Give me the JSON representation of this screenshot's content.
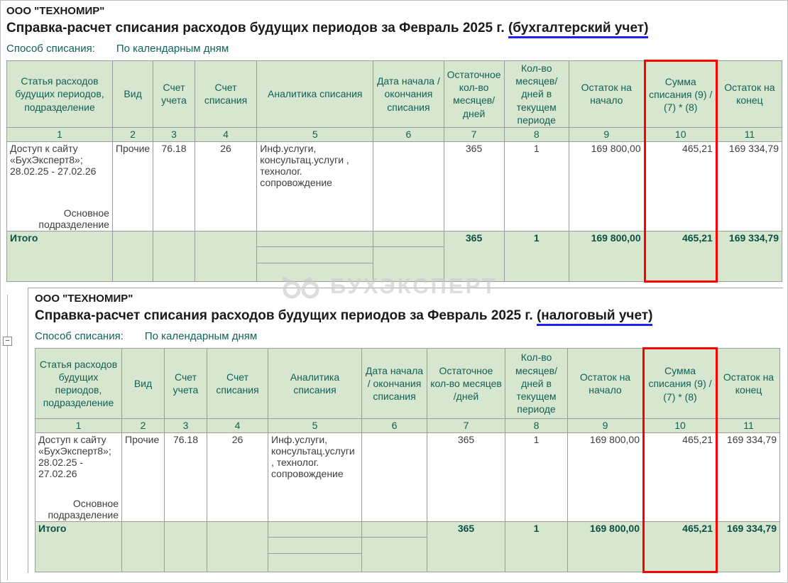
{
  "watermark": {
    "text": "БУХЭКСПЕРТ",
    "icon": "owl-glasses-icon"
  },
  "colors": {
    "header_green": "#d7e7cf",
    "teal_text": "#135f56",
    "highlight_red": "#ff0000",
    "underline_blue": "#2222ee"
  },
  "expander_glyph": "−",
  "blocks": [
    {
      "company": "ООО \"ТЕХНОМИР\"",
      "title": "Справка-расчет списания расходов будущих периодов за Февраль 2025 г.",
      "title_highlight": "(бухгалтерский учет)",
      "method_label": "Способ списания:",
      "method_value": "По календарным дням",
      "columns": [
        "Статья расходов будущих периодов, подразделение",
        "Вид",
        "Счет учета",
        "Счет списания",
        "Аналитика списания",
        "Дата начала / окончания списания",
        "Остаточное кол-во месяцев/ дней",
        "Кол-во месяцев/ дней в текущем периоде",
        "Остаток на начало",
        "Сумма списания (9) / (7) * (8)",
        "Остаток на конец"
      ],
      "column_numbers": [
        "1",
        "2",
        "3",
        "4",
        "5",
        "6",
        "7",
        "8",
        "9",
        "10",
        "11"
      ],
      "row": {
        "article": "Доступ к сайту «БухЭксперт8»; 28.02.25 - 27.02.26",
        "department": "Основное подразделение",
        "kind": "Прочие",
        "account": "76.18",
        "writeoff_account": "26",
        "analytics": "Инф.услуги, консультац.услуги , технолог. сопровождение",
        "remaining_qty": "365",
        "period_qty": "1",
        "balance_start": "169 800,00",
        "writeoff_sum": "465,21",
        "balance_end": "169 334,79"
      },
      "totals": {
        "label": "Итого",
        "remaining_qty": "365",
        "period_qty": "1",
        "balance_start": "169 800,00",
        "writeoff_sum": "465,21",
        "balance_end": "169 334,79"
      }
    },
    {
      "company": "ООО \"ТЕХНОМИР\"",
      "title": "Справка-расчет списания расходов будущих периодов за Февраль 2025 г.",
      "title_highlight": "(налоговый учет)",
      "method_label": "Способ списания:",
      "method_value": "По календарным дням",
      "columns": [
        "Статья расходов будущих периодов, подразделение",
        "Вид",
        "Счет учета",
        "Счет списания",
        "Аналитика списания",
        "Дата начала / окончания списания",
        "Остаточное кол-во месяцев /дней",
        "Кол-во месяцев/ дней в текущем периоде",
        "Остаток на начало",
        "Сумма списания (9) / (7) * (8)",
        "Остаток на конец"
      ],
      "column_numbers": [
        "1",
        "2",
        "3",
        "4",
        "5",
        "6",
        "7",
        "8",
        "9",
        "10",
        "11"
      ],
      "row": {
        "article": "Доступ к сайту «БухЭксперт8»; 28.02.25 - 27.02.26",
        "department": "Основное подразделение",
        "kind": "Прочие",
        "account": "76.18",
        "writeoff_account": "26",
        "analytics": "Инф.услуги, консультац.услуги , технолог. сопровождение",
        "remaining_qty": "365",
        "period_qty": "1",
        "balance_start": "169 800,00",
        "writeoff_sum": "465,21",
        "balance_end": "169 334,79"
      },
      "totals": {
        "label": "Итого",
        "remaining_qty": "365",
        "period_qty": "1",
        "balance_start": "169 800,00",
        "writeoff_sum": "465,21",
        "balance_end": "169 334,79"
      }
    }
  ]
}
